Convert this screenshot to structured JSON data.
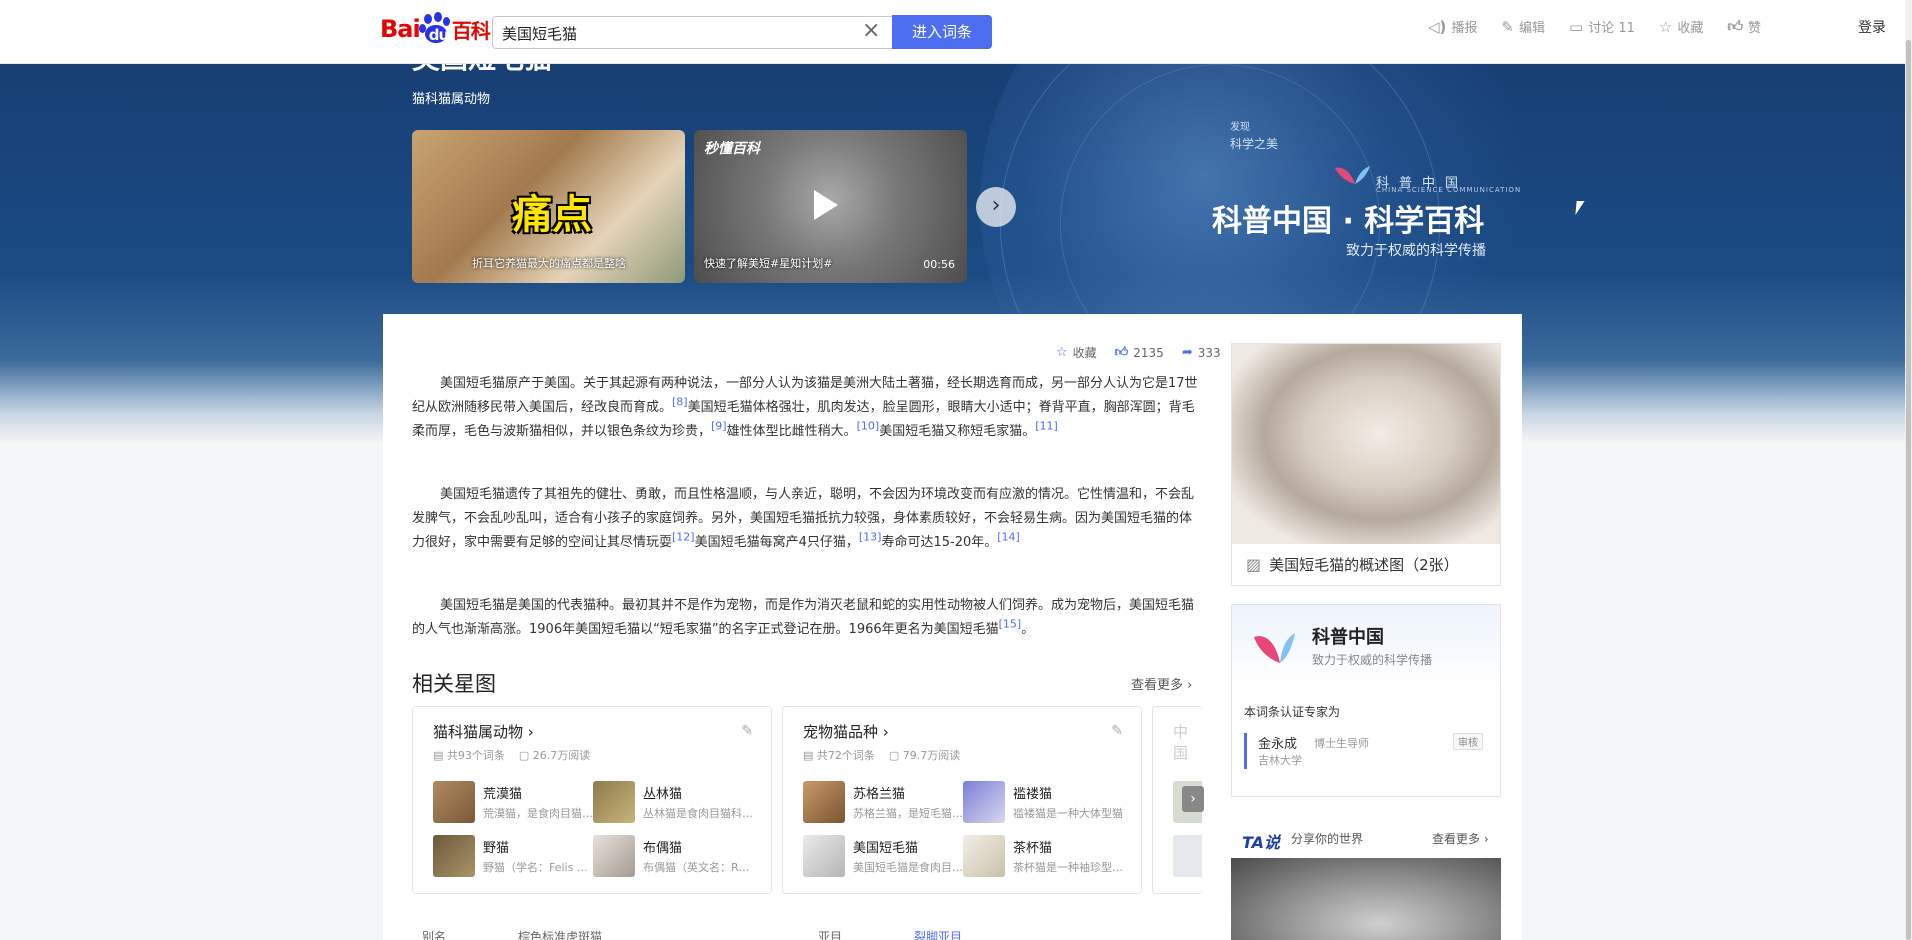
{
  "header": {
    "logo_bai": "Bai",
    "logo_du": "du",
    "logo_baike": "百科",
    "search_value": "美国短毛猫",
    "enter_button": "进入词条",
    "tools": [
      {
        "icon": "speaker-icon",
        "label": "播报"
      },
      {
        "icon": "edit-icon",
        "label": "编辑"
      },
      {
        "icon": "comment-icon",
        "label": "讨论 11"
      },
      {
        "icon": "star-icon",
        "label": "收藏"
      },
      {
        "icon": "thumbs-up-icon",
        "label": "赞"
      }
    ],
    "login": "登录"
  },
  "banner": {
    "title": "美国短毛猫",
    "subtitle": "猫科猫属动物",
    "videos": [
      {
        "overlay": "痛点",
        "caption": "折耳它养猫最大的痛点都是整啥"
      },
      {
        "brand": "秒懂百科",
        "caption": "快速了解美短#星知计划#",
        "duration": "00:56"
      }
    ],
    "kepu_small1": "发现",
    "kepu_small2": "科学之美",
    "kepu_cn": "科普中国",
    "kepu_en": "CHINA SCIENCE COMMUNICATION",
    "kepu_title": "科普中国 · 科学百科",
    "kepu_slogan": "致力于权威的科学传播"
  },
  "actions": {
    "collect": "收藏",
    "likes": "2135",
    "shares": "333"
  },
  "paragraphs": {
    "p1a": "美国短毛猫原产于美国。关于其起源有两种说法，一部分人认为该猫是美洲大陆土著猫，经长期选育而成，另一部分人认为它是17世纪从欧洲随移民带入美国后，经改良而育成。",
    "r8": "[8]",
    "p1b": "美国短毛猫体格强壮，肌肉发达，脸呈圆形，眼睛大小适中；脊背平直，胸部浑圆；背毛柔而厚，毛色与波斯猫相似，并以银色条纹为珍贵，",
    "r9": "[9]",
    "p1c": "雄性体型比雌性稍大。",
    "r10": "[10]",
    "p1d": "美国短毛猫又称短毛家猫。",
    "r11": "[11]",
    "p2a": "美国短毛猫遗传了其祖先的健壮、勇敢，而且性格温顺，与人亲近，聪明，不会因为环境改变而有应激的情况。它性情温和，不会乱发脾气，不会乱吵乱叫，适合有小孩子的家庭饲养。另外，美国短毛猫抵抗力较强，身体素质较好，不会轻易生病。因为美国短毛猫的体力很好，家中需要有足够的空间让其尽情玩耍",
    "r12": "[12]",
    "p2b": "美国短毛猫每窝产4只仔猫，",
    "r13": "[13]",
    "p2c": "寿命可达15-20年。",
    "r14": "[14]",
    "p3a": "美国短毛猫是美国的代表猫种。最初其并不是作为宠物，而是作为消灭老鼠和蛇的实用性动物被人们饲养。成为宠物后，美国短毛猫的人气也渐渐高涨。1906年美国短毛猫以“短毛家猫”的名字正式登记在册。1966年更名为美国短毛猫",
    "r15": "[15]",
    "p3b": "。"
  },
  "related": {
    "title": "相关星图",
    "see_more": "查看更多",
    "cards": [
      {
        "heading": "猫科猫属动物",
        "count": "共93个词条",
        "reads": "26.7万阅读",
        "items": [
          {
            "title": "荒漠猫",
            "desc": "荒漠猫，是食肉目猫科猫属动物"
          },
          {
            "title": "丛林猫",
            "desc": "丛林猫是食肉目猫科猫属动物"
          },
          {
            "title": "野猫",
            "desc": "野猫（学名：Felis silvestris）"
          },
          {
            "title": "布偶猫",
            "desc": "布偶猫（英文名：Ragdoll）"
          }
        ]
      },
      {
        "heading": "宠物猫品种",
        "count": "共72个词条",
        "reads": "79.7万阅读",
        "items": [
          {
            "title": "苏格兰猫",
            "desc": "苏格兰猫，是短毛猫品种"
          },
          {
            "title": "褴褛猫",
            "desc": "褴褛猫是一种大体型猫"
          },
          {
            "title": "美国短毛猫",
            "desc": "美国短毛猫是食肉目猫科"
          },
          {
            "title": "茶杯猫",
            "desc": "茶杯猫是一种袖珍型的猫"
          }
        ]
      },
      {
        "heading": "中国"
      }
    ]
  },
  "info_row": {
    "k1": "别名",
    "v1": "棕色标准虎斑猫",
    "k2": "亚目",
    "v2": "裂脚亚目"
  },
  "sidebar": {
    "album_caption": "美国短毛猫的概述图（2张）",
    "kepu_name": "科普中国",
    "kepu_slogan": "致力于权威的科学传播",
    "expert_label": "本词条认证专家为",
    "expert_name": "金永成",
    "expert_title": "博士生导师",
    "expert_badge": "审核",
    "expert_org": "吉林大学",
    "ta_head": "TA说",
    "ta_share": "分享你的世界",
    "ta_more": "查看更多"
  }
}
